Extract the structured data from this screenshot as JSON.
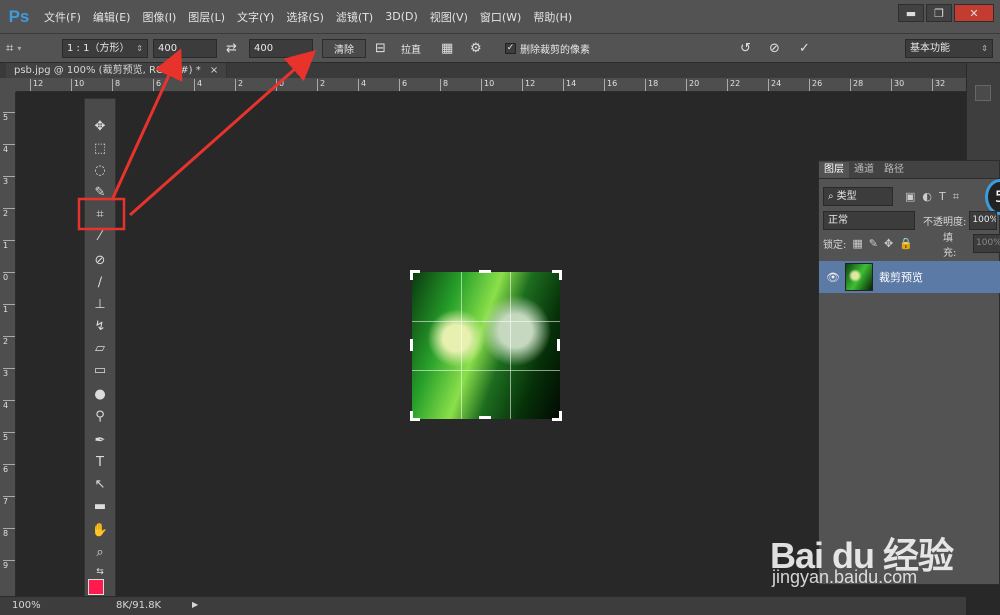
{
  "app": {
    "logo": "Ps"
  },
  "menu": [
    "文件(F)",
    "编辑(E)",
    "图像(I)",
    "图层(L)",
    "文字(Y)",
    "选择(S)",
    "滤镜(T)",
    "3D(D)",
    "视图(V)",
    "窗口(W)",
    "帮助(H)"
  ],
  "window_controls": {
    "minimize": "▬",
    "restore": "❐",
    "close": "✕"
  },
  "options": {
    "ratio_select": "1 : 1（方形）",
    "width_value": "400",
    "height_value": "400",
    "clear_label": "清除",
    "straighten_label": "拉直",
    "delete_cropped_label": "删除裁剪的像素",
    "workspace_select": "基本功能"
  },
  "document_tab": {
    "title": "psb.jpg @ 100% (裁剪预览, RGB/8#) *",
    "close": "×"
  },
  "ruler": {
    "top_labels": [
      "12",
      "10",
      "8",
      "6",
      "4",
      "2",
      "0",
      "2",
      "4",
      "6",
      "8",
      "10",
      "12",
      "14",
      "16",
      "18",
      "20",
      "22",
      "24",
      "26",
      "28",
      "30",
      "32"
    ],
    "left_labels": [
      "5",
      "4",
      "3",
      "2",
      "1",
      "0",
      "1",
      "2",
      "3",
      "4",
      "5",
      "6",
      "7",
      "8",
      "9"
    ]
  },
  "layers_panel": {
    "tabs": [
      "图层",
      "通道",
      "路径"
    ],
    "filter_kind": "类型",
    "blend_mode": "正常",
    "opacity_label": "不透明度:",
    "opacity_value": "100%",
    "lock_label": "锁定:",
    "fill_label": "填充:",
    "fill_value": "100%",
    "layer_name": "裁剪预览",
    "badge": "5"
  },
  "status": {
    "zoom": "100%",
    "doc_size": "8K/91.8K"
  },
  "watermark": {
    "logo": "Bai du 经验",
    "site": "jingyan.baidu.com"
  },
  "colors": {
    "foreground": "#ff1a4f",
    "background": "#000000",
    "accent": "#3d9bdf",
    "annotation": "#e8332c"
  }
}
